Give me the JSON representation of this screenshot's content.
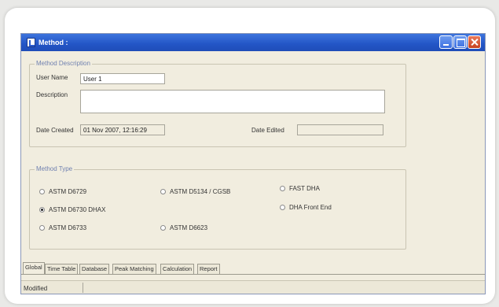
{
  "window": {
    "title": "Method :"
  },
  "description_group": {
    "legend": "Method Description",
    "user_name_label": "User Name",
    "user_name_value": "User 1",
    "description_label": "Description",
    "description_value": "",
    "date_created_label": "Date Created",
    "date_created_value": "01 Nov 2007, 12:16:29",
    "date_edited_label": "Date Edited",
    "date_edited_value": ""
  },
  "method_type_group": {
    "legend": "Method Type",
    "options": [
      {
        "label": "ASTM D6729",
        "checked": false
      },
      {
        "label": "ASTM D5134 / CGSB",
        "checked": false
      },
      {
        "label": "FAST DHA",
        "checked": false
      },
      {
        "label": "ASTM D6730 DHAX",
        "checked": true
      },
      {
        "label": "DHA Front End",
        "checked": false
      },
      {
        "label": "ASTM D6733",
        "checked": false
      },
      {
        "label": "ASTM D6623",
        "checked": false
      }
    ]
  },
  "tabs": [
    {
      "label": "Global",
      "active": true
    },
    {
      "label": "Time Table",
      "active": false
    },
    {
      "label": "Database",
      "active": false
    },
    {
      "label": "Peak Matching",
      "active": false
    },
    {
      "label": "Calculation",
      "active": false
    },
    {
      "label": "Report",
      "active": false
    }
  ],
  "status": {
    "text": "Modified"
  },
  "colors": {
    "title_bar": "#2355c6",
    "window_bg": "#f1eddf",
    "legend": "#7081b0",
    "close": "#c6411f"
  }
}
